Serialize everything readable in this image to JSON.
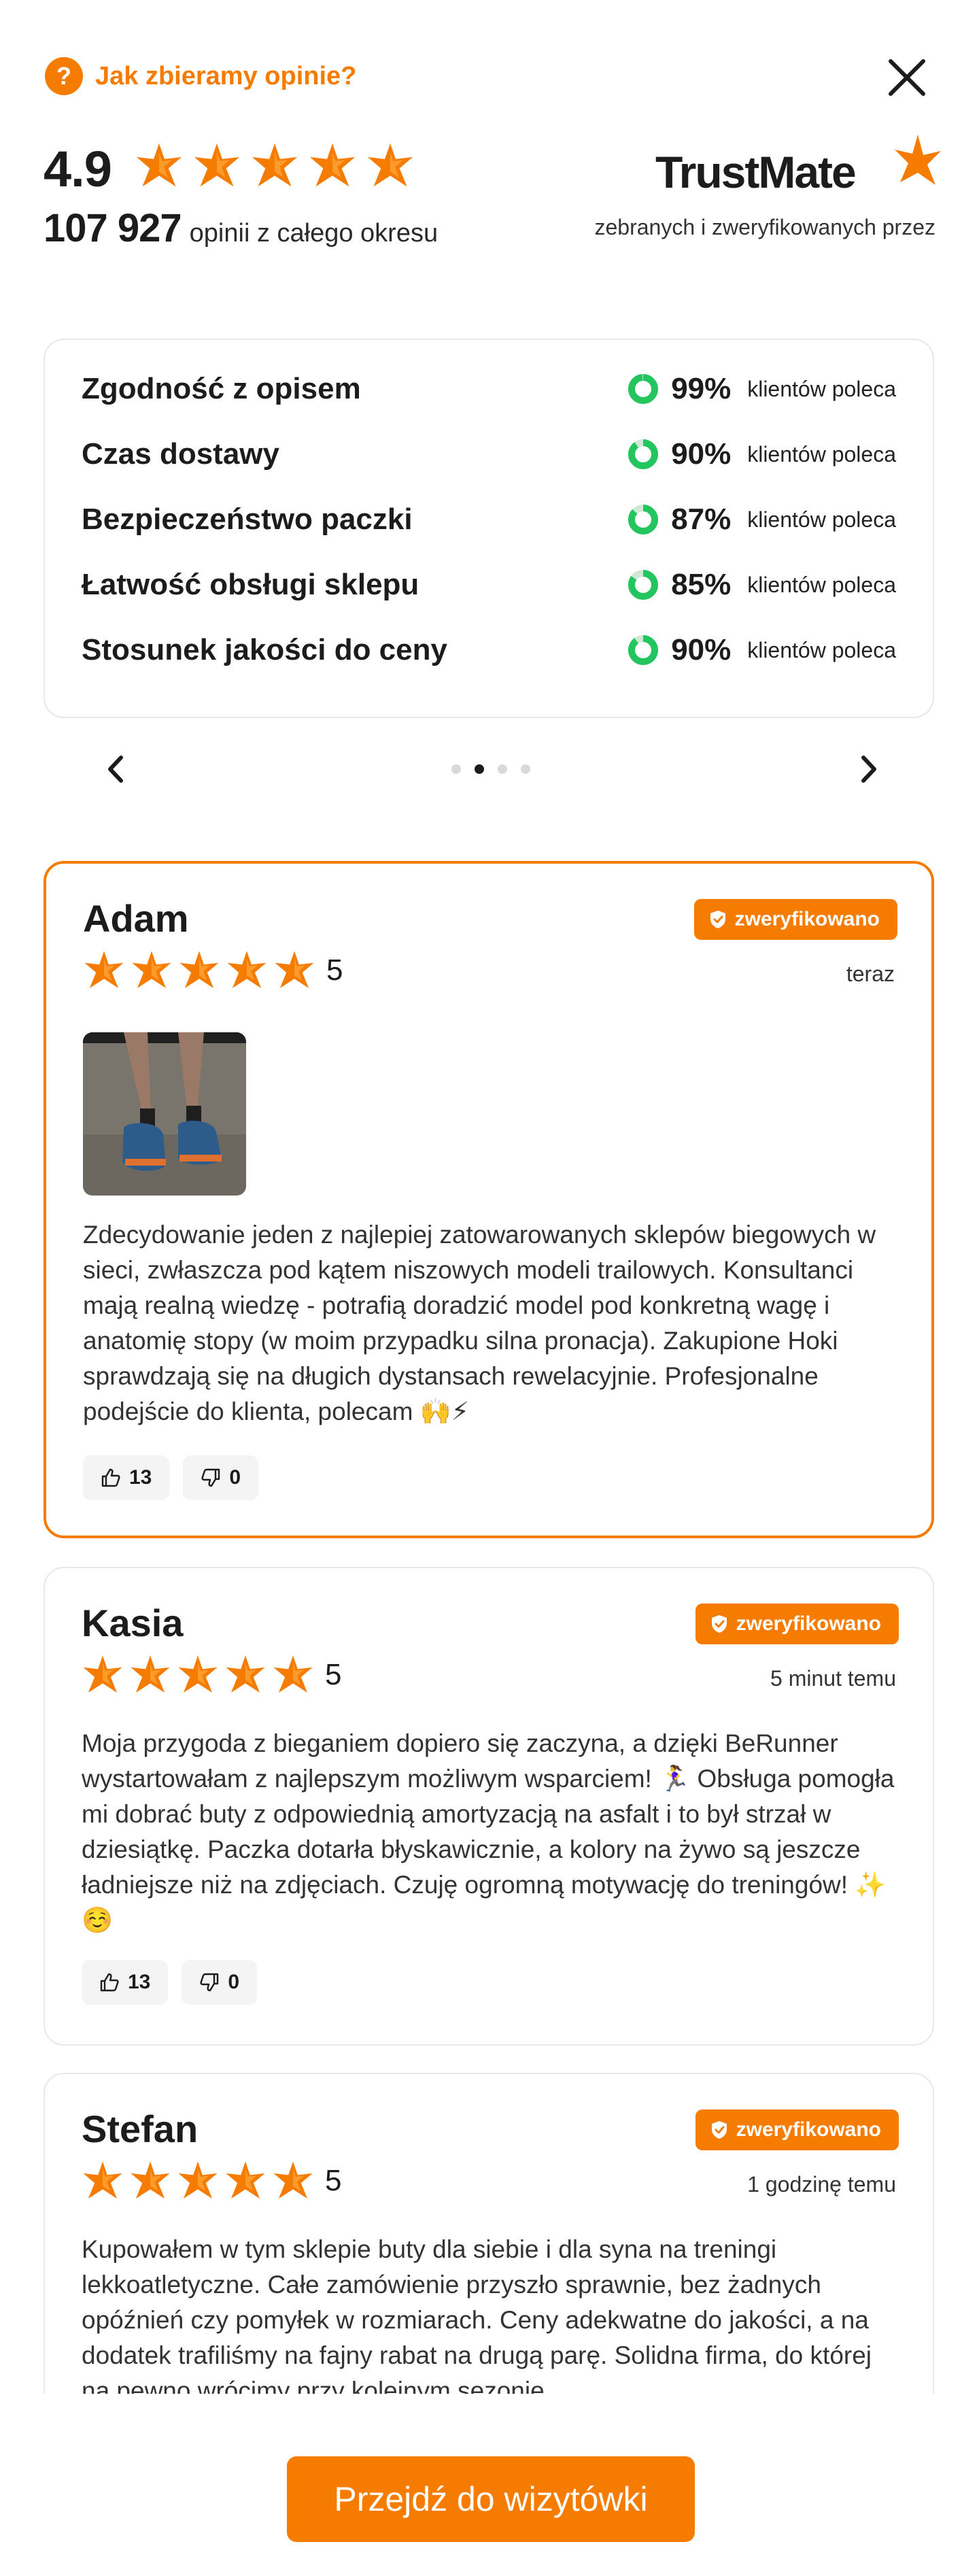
{
  "header": {
    "help_label": "Jak zbieramy opinie?",
    "help_icon_glyph": "?",
    "average": "4.9",
    "stars": 5,
    "review_count": "107 927",
    "review_count_caption": "opinii z całego okresu",
    "brand_name": "TrustMate",
    "brand_caption": "zebranych i zweryfikowanych przez"
  },
  "colors": {
    "accent": "#f57c00",
    "star": "#f57c00",
    "donut_fill": "#22c55e",
    "donut_track": "#cfe9d6"
  },
  "summary": {
    "items": [
      {
        "label": "Zgodność z opisem",
        "percent": "99%",
        "value": 99,
        "caption": "klientów poleca"
      },
      {
        "label": "Czas dostawy",
        "percent": "90%",
        "value": 90,
        "caption": "klientów poleca"
      },
      {
        "label": "Bezpieczeństwo paczki",
        "percent": "87%",
        "value": 87,
        "caption": "klientów poleca"
      },
      {
        "label": "Łatwość obsługi sklepu",
        "percent": "85%",
        "value": 85,
        "caption": "klientów poleca"
      },
      {
        "label": "Stosunek jakości do ceny",
        "percent": "90%",
        "value": 90,
        "caption": "klientów poleca"
      }
    ],
    "pages": 4,
    "active_page": 2
  },
  "reviews": [
    {
      "author": "Adam",
      "verified_label": "zweryfikowano",
      "rating": 5,
      "score": "5",
      "time": "teraz",
      "has_photo": true,
      "text": "Zdecydowanie jeden z najlepiej zatowarowanych sklepów biegowych w sieci, zwłaszcza pod kątem niszowych modeli trailowych. Konsultanci mają realną wiedzę - potrafią doradzić model pod konkretną wagę i anatomię stopy (w moim przypadku silna pronacja). Zakupione Hoki sprawdzają się na długich dystansach rewelacyjnie. Profesjonalne podejście do klienta, polecam 🙌⚡",
      "likes": "13",
      "dislikes": "0"
    },
    {
      "author": "Kasia",
      "verified_label": "zweryfikowano",
      "rating": 5,
      "score": "5",
      "time": "5 minut temu",
      "has_photo": false,
      "text": "Moja przygoda z bieganiem dopiero się zaczyna, a dzięki BeRunner wystartowałam z najlepszym możliwym wsparciem! 🏃‍♀️ Obsługa pomogła mi dobrać buty z odpowiednią amortyzacją na asfalt i to był strzał w dziesiątkę. Paczka dotarła błyskawicznie, a kolory na żywo są jeszcze ładniejsze niż na zdjęciach. Czuję ogromną motywację do treningów! ✨☺️",
      "likes": "13",
      "dislikes": "0"
    },
    {
      "author": "Stefan",
      "verified_label": "zweryfikowano",
      "rating": 5,
      "score": "5",
      "time": "1 godzinę temu",
      "has_photo": false,
      "text": "Kupowałem w tym sklepie buty dla siebie i dla syna na treningi lekkoatletyczne. Całe zamówienie przyszło sprawnie, bez żadnych opóźnień czy pomyłek w rozmiarach. Ceny adekwatne do jakości, a na dodatek trafiliśmy na fajny rabat na drugą parę. Solidna firma, do której na pewno wrócimy przy kolejnym sezonie.",
      "likes": "",
      "dislikes": ""
    }
  ],
  "cta": {
    "label": "Przejdź do wizytówki"
  }
}
